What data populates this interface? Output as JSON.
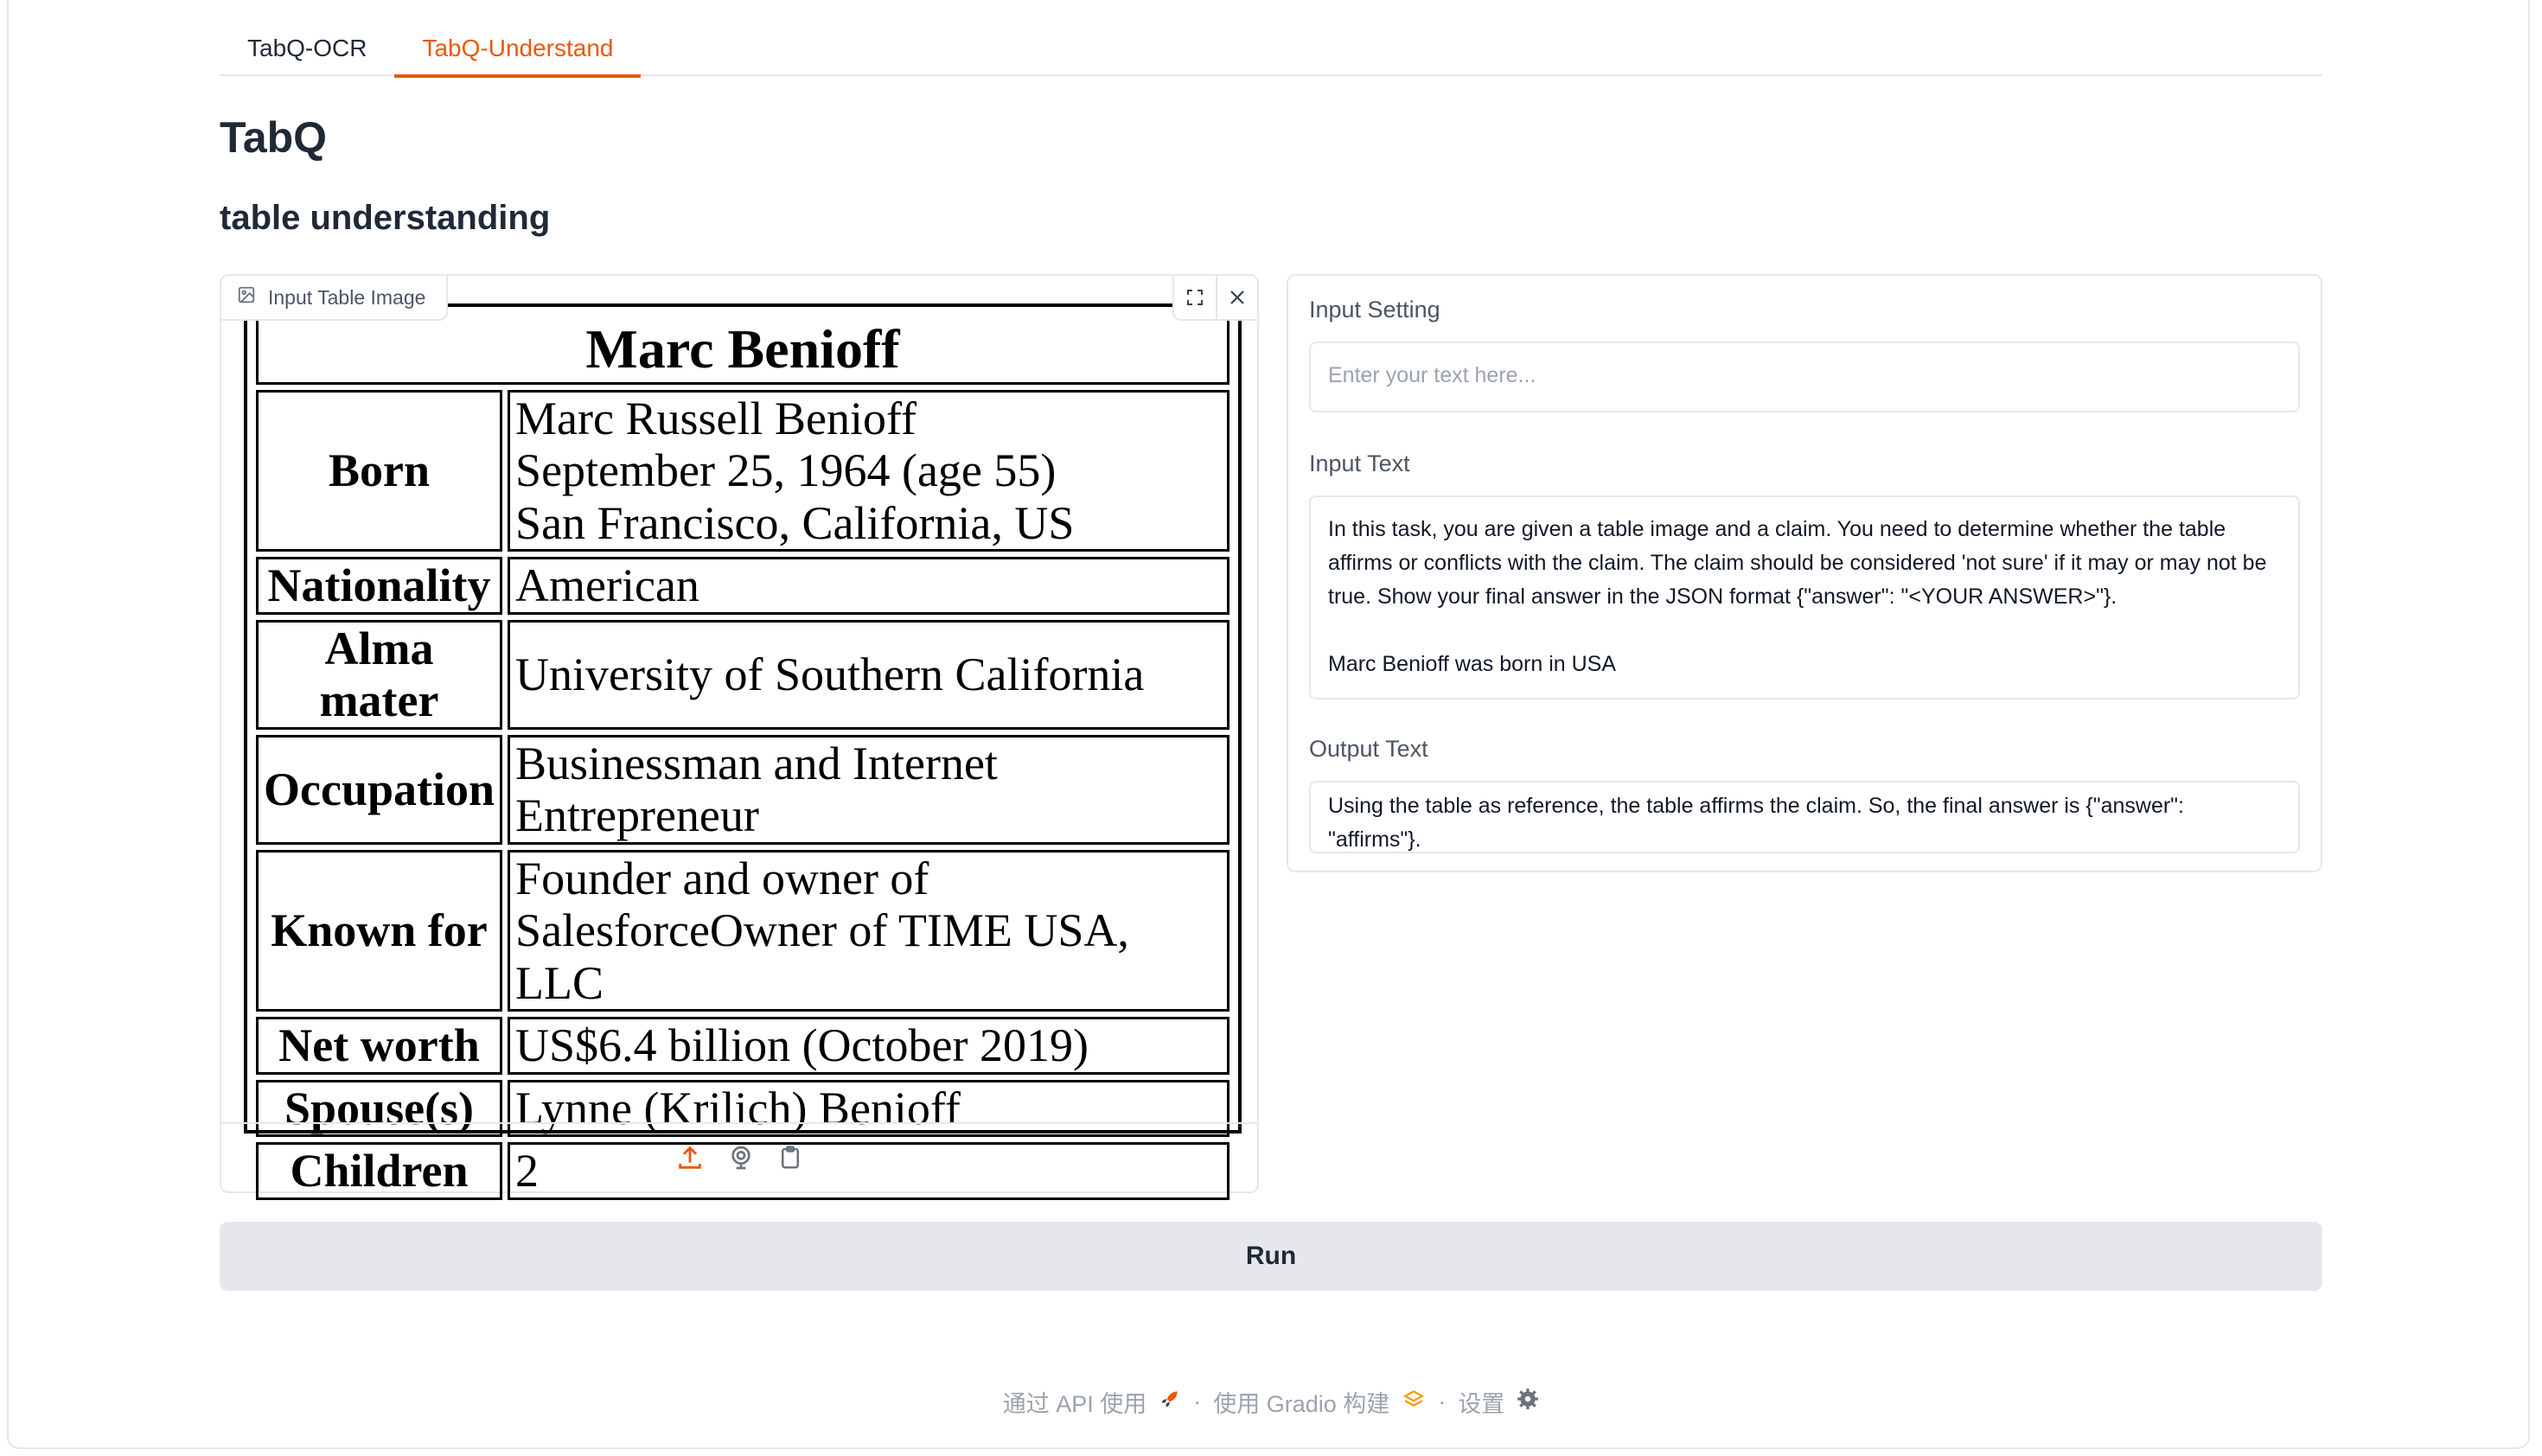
{
  "tabs": [
    {
      "label": "TabQ-OCR",
      "active": false
    },
    {
      "label": "TabQ-Understand",
      "active": true
    }
  ],
  "title": "TabQ",
  "subtitle": "table understanding",
  "image_panel": {
    "label": "Input Table Image",
    "table": {
      "title": "Marc Benioff",
      "rows": [
        {
          "key": "Born",
          "value": "Marc Russell Benioff\nSeptember 25, 1964 (age 55)\nSan Francisco, California, US"
        },
        {
          "key": "Nationality",
          "value": "American"
        },
        {
          "key": "Alma mater",
          "value": "University of Southern California"
        },
        {
          "key": "Occupation",
          "value": "Businessman and Internet Entrepreneur"
        },
        {
          "key": "Known for",
          "value": "Founder and owner of\nSalesforceOwner of TIME USA, LLC"
        },
        {
          "key": "Net worth",
          "value": "US$6.4 billion (October 2019)"
        },
        {
          "key": "Spouse(s)",
          "value": "Lynne (Krilich) Benioff"
        },
        {
          "key": "Children",
          "value": "2"
        }
      ]
    },
    "icons": [
      "image-icon",
      "fullscreen-icon",
      "close-icon",
      "upload-icon",
      "webcam-icon",
      "clipboard-icon"
    ]
  },
  "settings": {
    "input_setting_label": "Input Setting",
    "input_setting_placeholder": "Enter your text here...",
    "input_text_label": "Input Text",
    "input_text_value": "In this task, you are given a table image and a claim. You need to determine whether the table affirms or conflicts with the claim. The claim should be considered 'not sure' if it may or may not be true. Show your final answer in the JSON format {\"answer\": \"<YOUR ANSWER>\"}.\n\nMarc Benioff was born in USA",
    "output_text_label": "Output Text",
    "output_text_value": "Using the table as reference, the table affirms the claim. So, the final answer is {\"answer\": \"affirms\"}."
  },
  "run_label": "Run",
  "footer": {
    "api": "通过 API 使用",
    "sep": "·",
    "built": "使用 Gradio 构建",
    "settings": "设置"
  },
  "colors": {
    "accent": "#ea580c",
    "border": "#e5e7eb",
    "button_bg": "#e5e7eb"
  }
}
